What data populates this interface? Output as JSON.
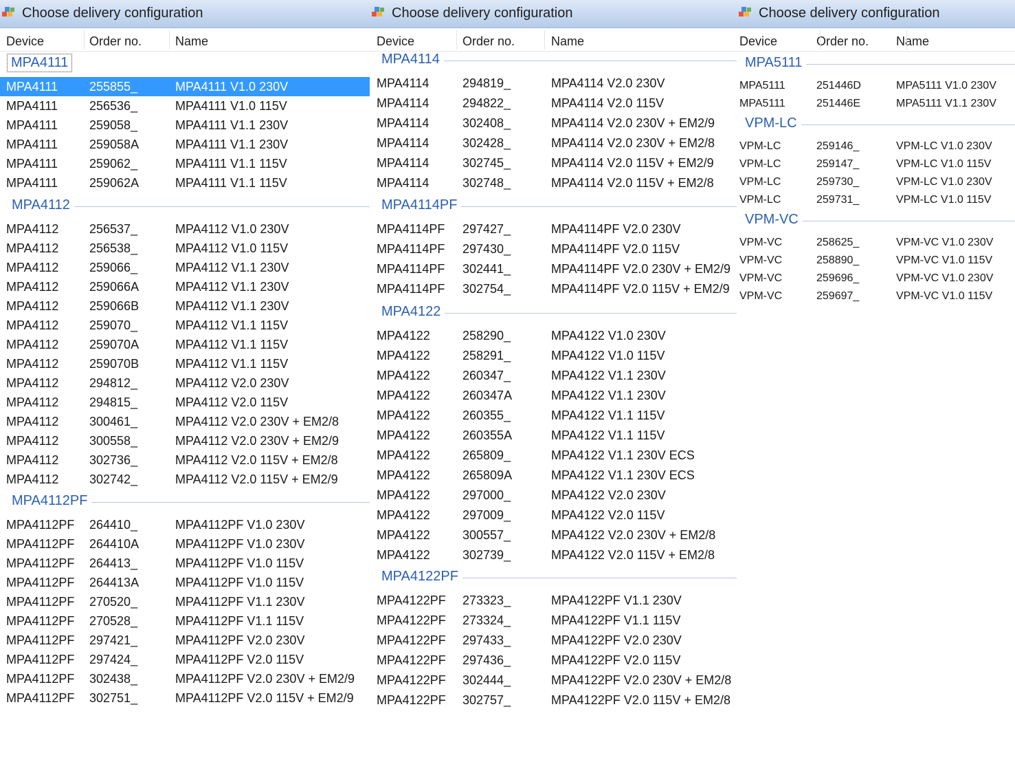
{
  "windows": [
    {
      "title": "Choose delivery configuration",
      "columns": [
        "Device",
        "Order no.",
        "Name"
      ],
      "groups": [
        {
          "name": "MPA4111",
          "rows": [
            [
              "MPA4111",
              "255855_",
              "MPA4111 V1.0 230V"
            ],
            [
              "MPA4111",
              "256536_",
              "MPA4111 V1.0 115V"
            ],
            [
              "MPA4111",
              "259058_",
              "MPA4111 V1.1 230V"
            ],
            [
              "MPA4111",
              "259058A",
              "MPA4111 V1.1 230V"
            ],
            [
              "MPA4111",
              "259062_",
              "MPA4111 V1.1 115V"
            ],
            [
              "MPA4111",
              "259062A",
              "MPA4111 V1.1 115V"
            ]
          ]
        },
        {
          "name": "MPA4112",
          "rows": [
            [
              "MPA4112",
              "256537_",
              "MPA4112 V1.0 230V"
            ],
            [
              "MPA4112",
              "256538_",
              "MPA4112 V1.0 115V"
            ],
            [
              "MPA4112",
              "259066_",
              "MPA4112 V1.1 230V"
            ],
            [
              "MPA4112",
              "259066A",
              "MPA4112 V1.1 230V"
            ],
            [
              "MPA4112",
              "259066B",
              "MPA4112 V1.1 230V"
            ],
            [
              "MPA4112",
              "259070_",
              "MPA4112 V1.1 115V"
            ],
            [
              "MPA4112",
              "259070A",
              "MPA4112 V1.1 115V"
            ],
            [
              "MPA4112",
              "259070B",
              "MPA4112 V1.1 115V"
            ],
            [
              "MPA4112",
              "294812_",
              "MPA4112 V2.0 230V"
            ],
            [
              "MPA4112",
              "294815_",
              "MPA4112 V2.0 115V"
            ],
            [
              "MPA4112",
              "300461_",
              "MPA4112 V2.0 230V + EM2/8"
            ],
            [
              "MPA4112",
              "300558_",
              "MPA4112 V2.0 230V + EM2/9"
            ],
            [
              "MPA4112",
              "302736_",
              "MPA4112 V2.0 115V + EM2/8"
            ],
            [
              "MPA4112",
              "302742_",
              "MPA4112 V2.0 115V + EM2/9"
            ]
          ]
        },
        {
          "name": "MPA4112PF",
          "rows": [
            [
              "MPA4112PF",
              "264410_",
              "MPA4112PF V1.0 230V"
            ],
            [
              "MPA4112PF",
              "264410A",
              "MPA4112PF V1.0 230V"
            ],
            [
              "MPA4112PF",
              "264413_",
              "MPA4112PF V1.0 115V"
            ],
            [
              "MPA4112PF",
              "264413A",
              "MPA4112PF V1.0 115V"
            ],
            [
              "MPA4112PF",
              "270520_",
              "MPA4112PF V1.1 230V"
            ],
            [
              "MPA4112PF",
              "270528_",
              "MPA4112PF V1.1 115V"
            ],
            [
              "MPA4112PF",
              "297421_",
              "MPA4112PF V2.0 230V"
            ],
            [
              "MPA4112PF",
              "297424_",
              "MPA4112PF V2.0 115V"
            ],
            [
              "MPA4112PF",
              "302438_",
              "MPA4112PF V2.0 230V + EM2/9"
            ],
            [
              "MPA4112PF",
              "302751_",
              "MPA4112PF V2.0 115V + EM2/9"
            ]
          ]
        }
      ]
    },
    {
      "title": "Choose delivery configuration",
      "columns": [
        "Device",
        "Order no.",
        "Name"
      ],
      "groups": [
        {
          "name": "MPA4114",
          "rows": [
            [
              "MPA4114",
              "294819_",
              "MPA4114 V2.0 230V"
            ],
            [
              "MPA4114",
              "294822_",
              "MPA4114 V2.0 115V"
            ],
            [
              "MPA4114",
              "302408_",
              "MPA4114 V2.0 230V + EM2/9"
            ],
            [
              "MPA4114",
              "302428_",
              "MPA4114 V2.0 230V + EM2/8"
            ],
            [
              "MPA4114",
              "302745_",
              "MPA4114 V2.0 115V + EM2/9"
            ],
            [
              "MPA4114",
              "302748_",
              "MPA4114 V2.0 115V + EM2/8"
            ]
          ]
        },
        {
          "name": "MPA4114PF",
          "rows": [
            [
              "MPA4114PF",
              "297427_",
              "MPA4114PF V2.0 230V"
            ],
            [
              "MPA4114PF",
              "297430_",
              "MPA4114PF V2.0 115V"
            ],
            [
              "MPA4114PF",
              "302441_",
              "MPA4114PF V2.0 230V + EM2/9"
            ],
            [
              "MPA4114PF",
              "302754_",
              "MPA4114PF V2.0 115V + EM2/9"
            ]
          ]
        },
        {
          "name": "MPA4122",
          "rows": [
            [
              "MPA4122",
              "258290_",
              "MPA4122 V1.0 230V"
            ],
            [
              "MPA4122",
              "258291_",
              "MPA4122 V1.0 115V"
            ],
            [
              "MPA4122",
              "260347_",
              "MPA4122 V1.1 230V"
            ],
            [
              "MPA4122",
              "260347A",
              "MPA4122 V1.1 230V"
            ],
            [
              "MPA4122",
              "260355_",
              "MPA4122 V1.1 115V"
            ],
            [
              "MPA4122",
              "260355A",
              "MPA4122 V1.1 115V"
            ],
            [
              "MPA4122",
              "265809_",
              "MPA4122 V1.1 230V ECS"
            ],
            [
              "MPA4122",
              "265809A",
              "MPA4122 V1.1 230V ECS"
            ],
            [
              "MPA4122",
              "297000_",
              "MPA4122 V2.0 230V"
            ],
            [
              "MPA4122",
              "297009_",
              "MPA4122 V2.0 115V"
            ],
            [
              "MPA4122",
              "300557_",
              "MPA4122 V2.0 230V + EM2/8"
            ],
            [
              "MPA4122",
              "302739_",
              "MPA4122 V2.0 115V + EM2/8"
            ]
          ]
        },
        {
          "name": "MPA4122PF",
          "rows": [
            [
              "MPA4122PF",
              "273323_",
              "MPA4122PF V1.1 230V"
            ],
            [
              "MPA4122PF",
              "273324_",
              "MPA4122PF V1.1 115V"
            ],
            [
              "MPA4122PF",
              "297433_",
              "MPA4122PF V2.0 230V"
            ],
            [
              "MPA4122PF",
              "297436_",
              "MPA4122PF V2.0 115V"
            ],
            [
              "MPA4122PF",
              "302444_",
              "MPA4122PF V2.0 230V + EM2/8"
            ],
            [
              "MPA4122PF",
              "302757_",
              "MPA4122PF V2.0 115V + EM2/8"
            ]
          ]
        }
      ]
    },
    {
      "title": "Choose delivery configuration",
      "columns": [
        "Device",
        "Order no.",
        "Name"
      ],
      "groups": [
        {
          "name": "MPA5111",
          "rows": [
            [
              "MPA5111",
              "251446D",
              "MPA5111 V1.0 230V"
            ],
            [
              "MPA5111",
              "251446E",
              "MPA5111 V1.1 230V"
            ]
          ]
        },
        {
          "name": "VPM-LC",
          "rows": [
            [
              "VPM-LC",
              "259146_",
              "VPM-LC V1.0 230V"
            ],
            [
              "VPM-LC",
              "259147_",
              "VPM-LC V1.0 115V"
            ],
            [
              "VPM-LC",
              "259730_",
              "VPM-LC V1.0 230V"
            ],
            [
              "VPM-LC",
              "259731_",
              "VPM-LC V1.0 115V"
            ]
          ]
        },
        {
          "name": "VPM-VC",
          "rows": [
            [
              "VPM-VC",
              "258625_",
              "VPM-VC V1.0 230V"
            ],
            [
              "VPM-VC",
              "258890_",
              "VPM-VC V1.0 115V"
            ],
            [
              "VPM-VC",
              "259696_",
              "VPM-VC V1.0 230V"
            ],
            [
              "VPM-VC",
              "259697_",
              "VPM-VC V1.0 115V"
            ]
          ]
        }
      ]
    }
  ]
}
